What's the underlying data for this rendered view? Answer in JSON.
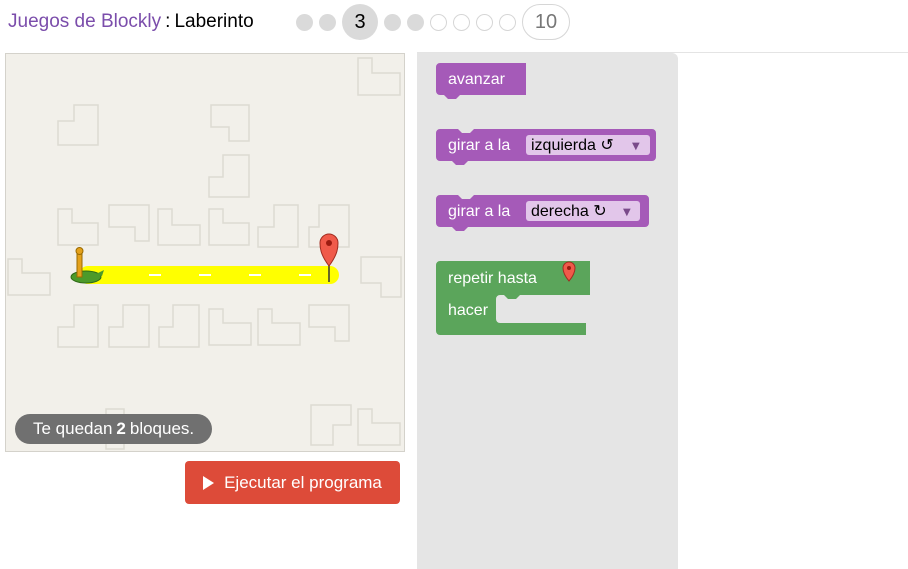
{
  "header": {
    "app_link": "Juegos de Blockly",
    "separator": ":",
    "title": "Laberinto",
    "levels": {
      "current": "3",
      "last": "10"
    }
  },
  "maze": {
    "hint_before": "Te quedan",
    "hint_count": "2",
    "hint_after": "bloques."
  },
  "run_button": {
    "label": "Ejecutar el programa"
  },
  "toolbox": {
    "block_move": "avanzar",
    "block_turn_left": "girar a la",
    "turn_left_option": "izquierda ↺",
    "block_turn_right": "girar a la",
    "turn_right_option": "derecha ↻",
    "repeat_until": "repetir hasta",
    "do_label": "hacer"
  },
  "colors": {
    "motion_block": "#a55ab8",
    "loop_block": "#5ba55b",
    "run_button": "#dd4b39",
    "link": "#7b4dab"
  }
}
